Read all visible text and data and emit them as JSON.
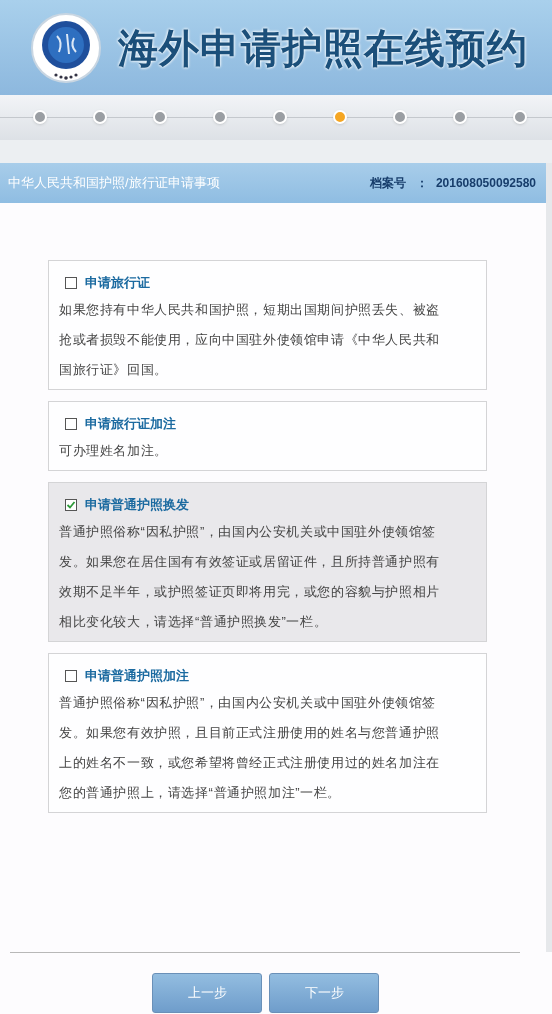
{
  "header": {
    "title": "海外申请护照在线预约"
  },
  "steps": [
    {
      "selected": false
    },
    {
      "selected": false
    },
    {
      "selected": false
    },
    {
      "selected": false
    },
    {
      "selected": false
    },
    {
      "selected": true
    },
    {
      "selected": false
    },
    {
      "selected": false
    },
    {
      "selected": false
    }
  ],
  "section": {
    "title": "中华人民共和国护照/旅行证申请事项",
    "file_label": "档案号",
    "separator": "：",
    "file_number": "201608050092580"
  },
  "options": [
    {
      "label": "申请旅行证",
      "checked": false,
      "description": "如果您持有中华人民共和国护照，短期出国期间护照丢失、被盗抢或者损毁不能使用，应向中国驻外使领馆申请《中华人民共和国旅行证》回国。"
    },
    {
      "label": "申请旅行证加注",
      "checked": false,
      "description": "可办理姓名加注。"
    },
    {
      "label": "申请普通护照换发",
      "checked": true,
      "description": "普通护照俗称“因私护照”，由国内公安机关或中国驻外使领馆签发。如果您在居住国有有效签证或居留证件，且所持普通护照有效期不足半年，或护照签证页即将用完，或您的容貌与护照相片相比变化较大，请选择“普通护照换发”一栏。"
    },
    {
      "label": "申请普通护照加注",
      "checked": false,
      "description": "普通护照俗称“因私护照”，由国内公安机关或中国驻外使领馆签发。如果您有效护照，且目前正式注册使用的姓名与您普通护照上的姓名不一致，或您希望将曾经正式注册使用过的姓名加注在您的普通护照上，请选择“普通护照加注”一栏。"
    }
  ],
  "buttons": [
    {
      "label": "上一步"
    },
    {
      "label": "下一步"
    }
  ]
}
